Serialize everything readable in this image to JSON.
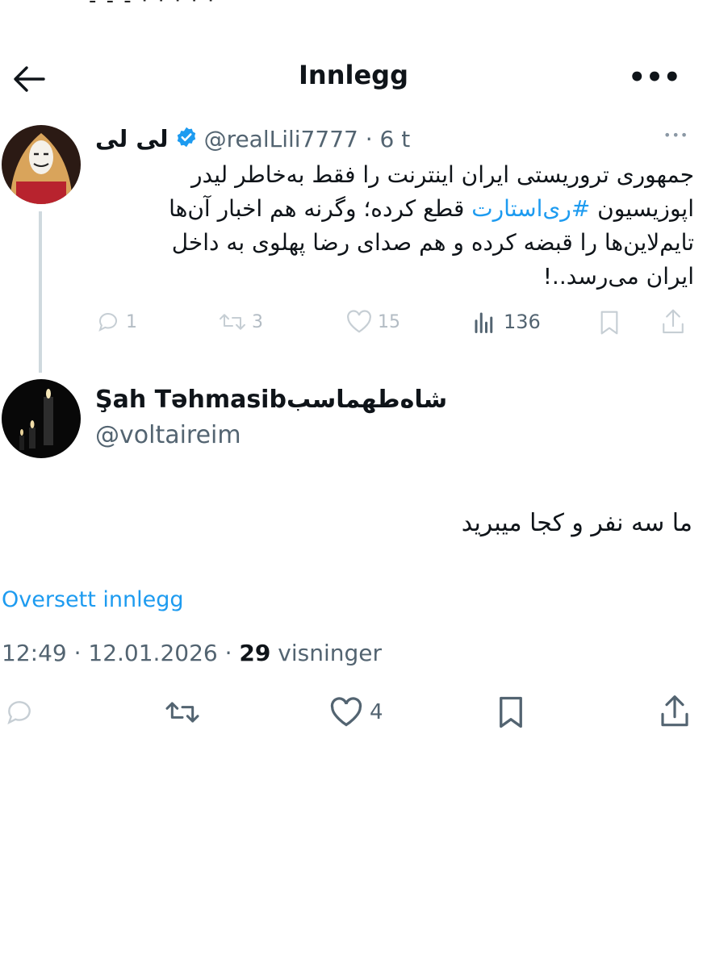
{
  "statusbar_fragment": "- - -          · · · · ·  ̄",
  "header": {
    "title": "Innlegg",
    "back_icon": "arrow-left-icon",
    "more_label": "•••"
  },
  "parent_tweet": {
    "display_name": "لی لی",
    "handle_time": "@realLili7777 · 6 t",
    "verified_color": "#1d9bf0",
    "text_line1": "جمهوری تروریستی ایران اینترنت را فقط به‌خاطر لیدر",
    "text_line2_pre": "اپوزیسیون ",
    "hashtag": "#ری‌استارت",
    "text_line2_post": " قطع کرده؛ وگرنه هم اخبار آن‌ها",
    "text_line3": "تایم‌لاین‌ها را قبضه  کرده و هم صدای رضا پهلوی به داخل",
    "text_line4": "ایران می‌رسد..!",
    "replies": "1",
    "reposts": "3",
    "likes": "15",
    "views": "136",
    "more_label": "•••"
  },
  "reply_tweet": {
    "display_name": "Şah Təhmasibشاه‌طهماسب",
    "handle": "@voltaireim",
    "text": "ما سه نفر و کجا میبرید",
    "translate_label": "Oversett innlegg",
    "meta_time": "12:49 · 12.01.2026 · ",
    "meta_views_count": "29",
    "meta_views_label": " visninger",
    "likes": "4"
  },
  "colors": {
    "accent": "#1d9bf0",
    "text": "#0f1419",
    "muted": "#536471"
  }
}
